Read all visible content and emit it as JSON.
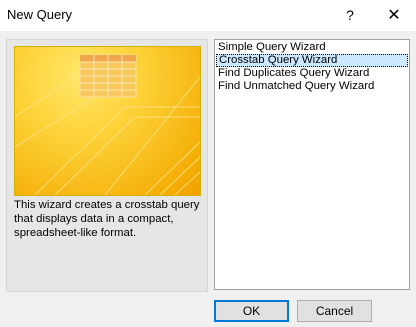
{
  "window": {
    "title": "New Query",
    "help_label": "?",
    "close_label": "✕"
  },
  "preview": {
    "icon": "crosstab-query-wizard-illustration",
    "colors": {
      "accent": "#fdd33a",
      "grid": "#f8c85c"
    }
  },
  "description": "This wizard creates a crosstab query that displays data in a compact, spreadsheet-like format.",
  "wizards": [
    {
      "label": "Simple Query Wizard",
      "selected": false
    },
    {
      "label": "Crosstab Query Wizard",
      "selected": true
    },
    {
      "label": "Find Duplicates Query Wizard",
      "selected": false
    },
    {
      "label": "Find Unmatched Query Wizard",
      "selected": false
    }
  ],
  "buttons": {
    "ok": "OK",
    "cancel": "Cancel"
  }
}
